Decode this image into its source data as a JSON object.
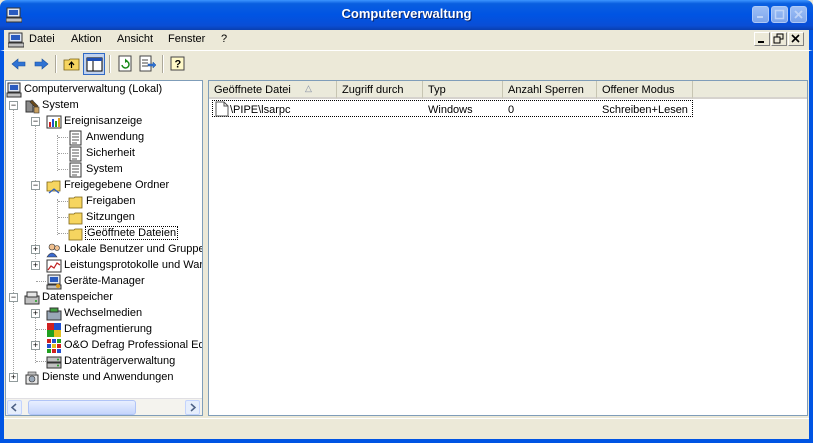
{
  "window": {
    "title": "Computerverwaltung"
  },
  "menu": {
    "items": [
      "Datei",
      "Aktion",
      "Ansicht",
      "Fenster",
      "?"
    ]
  },
  "tree": {
    "root": "Computerverwaltung (Lokal)",
    "system": "System",
    "ereignisanzeige": "Ereignisanzeige",
    "anwendung": "Anwendung",
    "sicherheit": "Sicherheit",
    "system_log": "System",
    "freigegebene_ordner": "Freigegebene Ordner",
    "freigaben": "Freigaben",
    "sitzungen": "Sitzungen",
    "geoeffnete_dateien": "Geöffnete Dateien",
    "lokale_benutzer": "Lokale Benutzer und Gruppen",
    "leistungsprotokolle": "Leistungsprotokolle und Warnungen",
    "geraete_manager": "Geräte-Manager",
    "datenspeicher": "Datenspeicher",
    "wechselmedien": "Wechselmedien",
    "defragmentierung": "Defragmentierung",
    "oo_defrag": "O&O Defrag Professional Edition",
    "datentraegerverwaltung": "Datenträgerverwaltung",
    "dienste": "Dienste und Anwendungen"
  },
  "list": {
    "columns": [
      "Geöffnete Datei",
      "Zugriff durch",
      "Typ",
      "Anzahl Sperren",
      "Offener Modus"
    ],
    "sort_indicator": "△",
    "rows": [
      {
        "datei": "\\PIPE\\lsarpc",
        "zugriff": "",
        "typ": "Windows",
        "sperren": "0",
        "modus": "Schreiben+Lesen"
      }
    ]
  }
}
